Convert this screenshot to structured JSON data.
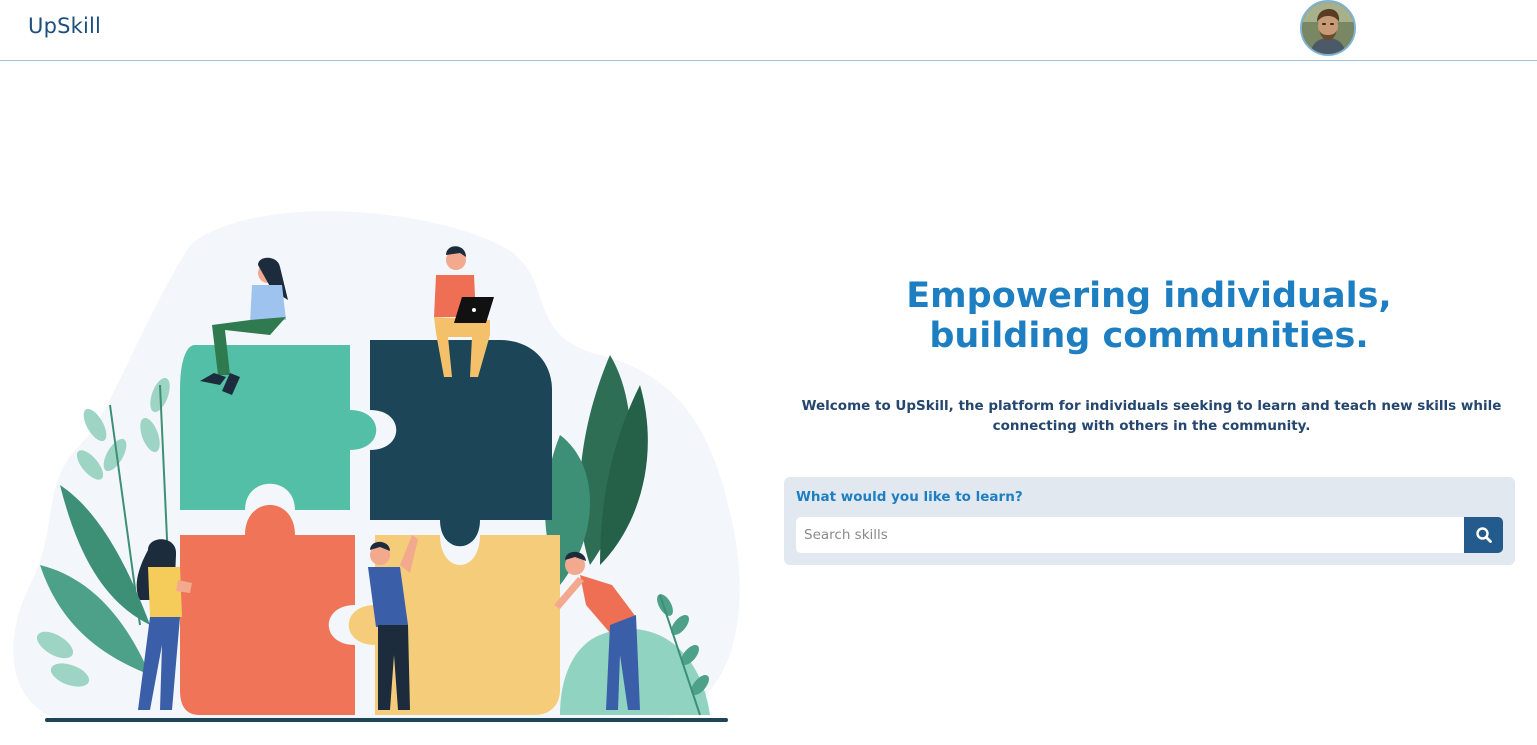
{
  "navbar": {
    "brand": "UpSkill",
    "avatar_icon": "user-avatar-icon"
  },
  "hero": {
    "headline_line1": "Empowering individuals,",
    "headline_line2": "building communities.",
    "welcome_text": "Welcome to UpSkill, the platform for individuals seeking to learn and teach new skills while connecting with others in the community."
  },
  "search": {
    "label": "What would you like to learn?",
    "placeholder": "Search skills",
    "value": "",
    "button_icon": "search-icon"
  },
  "colors": {
    "brand": "#1d4f7c",
    "accent": "#1d7fc2",
    "search_button": "#235c8c",
    "panel": "#e1e8f0"
  },
  "illustration": {
    "icon": "puzzle-teamwork-illustration"
  }
}
